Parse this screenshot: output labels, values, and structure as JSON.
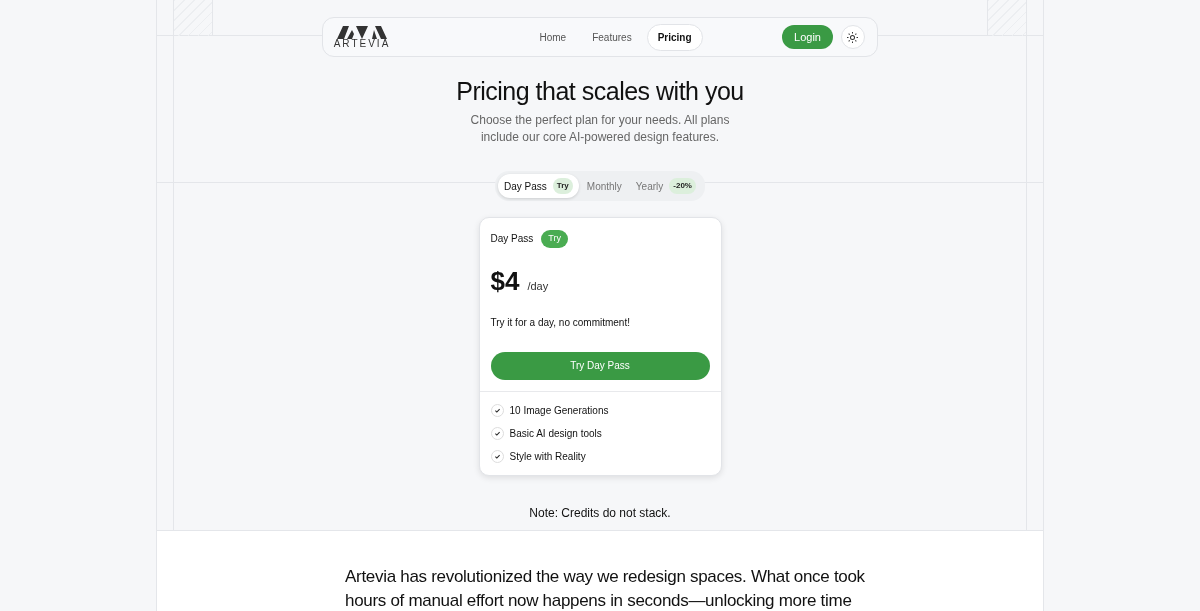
{
  "nav": {
    "logo_text": "ARTEVIA",
    "links": [
      {
        "label": "Home",
        "selected": false
      },
      {
        "label": "Features",
        "selected": false
      },
      {
        "label": "Pricing",
        "selected": true
      }
    ],
    "login": "Login"
  },
  "hero": {
    "title": "Pricing that scales with you",
    "subtitle": "Choose the perfect plan for your needs. All plans include our core AI-powered design features."
  },
  "billing_tabs": [
    {
      "label": "Day Pass",
      "badge": "Try",
      "selected": true
    },
    {
      "label": "Monthly",
      "selected": false
    },
    {
      "label": "Yearly",
      "badge": "-20%",
      "selected": false
    }
  ],
  "plan": {
    "name": "Day Pass",
    "badge": "Try",
    "price": "$4",
    "period": "/day",
    "description": "Try it for a day, no commitment!",
    "button": "Try Day Pass",
    "features": [
      "10 Image Generations",
      "Basic AI design tools",
      "Style with Reality"
    ]
  },
  "note": "Note: Credits do not stack.",
  "testimonial": "Artevia has revolutionized the way we redesign spaces. What once took hours of manual effort now happens in seconds—unlocking more time"
}
